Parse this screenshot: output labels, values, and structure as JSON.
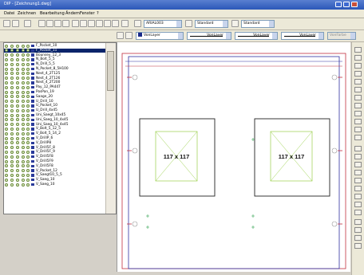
{
  "window": {
    "title": "DIP - [Zeichnung1.dwg]"
  },
  "menu": [
    "Datei",
    "Zeichnen",
    "Bearbeitung",
    "Ändern",
    "Fenster",
    "?"
  ],
  "toolbar": {
    "dimstyle_combo": "ARIAL003",
    "textstyle_combo": "Standard",
    "tablestyle_combo": "Standard",
    "layer_combo": "VonLayer",
    "linetype_combo": "VonLayer",
    "lineweight_combo": "VonLayer",
    "color_combo": "VonLayer",
    "plotstyle_combo": "VonFarbe"
  },
  "layers": [
    "F_Pocket_10",
    "F_Pocket_11",
    "Bounsey_12_3",
    "N_Bolt_5_5",
    "N_Drill_5_5",
    "N_Pocket_8_5H100",
    "Nest_4_2T125",
    "Nest_4_2T126",
    "Nest_4_2T200",
    "Pay_12_PA447",
    "PosPan_19",
    "Saage_20",
    "U_Drill_10",
    "U_Pocket_10",
    "U_Drill_4x45",
    "Uni_Saegt_10x45",
    "Uni_Saeg_10_4x45",
    "Uni_Saeg_10_4x45",
    "V_Bolt_5_12_5",
    "V_Bolt_5_14_2",
    "V_DrillP_6",
    "V_DrillP8",
    "V_Drill5F_8",
    "V_Drill5F_9",
    "V_Drill5F8",
    "V_Drill5F9",
    "V_Drill5F8",
    "V_Pocket_12",
    "V_Saegt10_5_5",
    "V_Saeg_10",
    "V_Saeg_10"
  ],
  "selected_layer_index": 1,
  "canvas": {
    "box_labels": [
      "117 x 117",
      "117 x 117"
    ]
  },
  "colors": {
    "title_bar": "#2b57b8",
    "selection": "#0a246a",
    "frame_red": "#c03040",
    "frame_blue": "#3030a0",
    "yellow_green": "#9ad04a",
    "green_marker": "#2aa04a"
  }
}
